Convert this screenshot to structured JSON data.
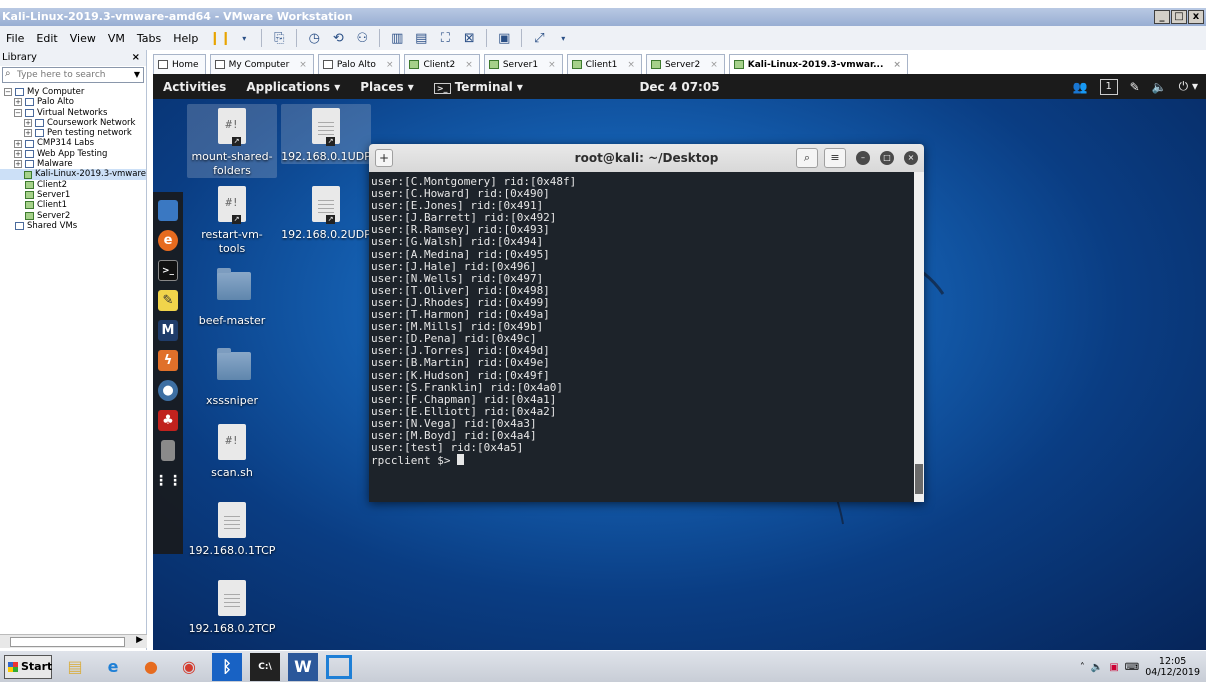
{
  "window": {
    "title": "Kali-Linux-2019.3-vmware-amd64 - VMware Workstation",
    "controls": [
      "_",
      "□",
      "x"
    ]
  },
  "menu": [
    "File",
    "Edit",
    "View",
    "VM",
    "Tabs",
    "Help"
  ],
  "library": {
    "title": "Library",
    "close": "×",
    "search_placeholder": "Type here to search",
    "tree": [
      {
        "label": "My Computer",
        "exp": "−",
        "indent": 0,
        "icon": "folder"
      },
      {
        "label": "Palo Alto",
        "exp": "+",
        "indent": 1,
        "icon": "folder"
      },
      {
        "label": "Virtual Networks",
        "exp": "−",
        "indent": 1,
        "icon": "folder"
      },
      {
        "label": "Coursework Network",
        "exp": "+",
        "indent": 2,
        "icon": "folder"
      },
      {
        "label": "Pen testing network",
        "exp": "+",
        "indent": 2,
        "icon": "folder"
      },
      {
        "label": "CMP314 Labs",
        "exp": "+",
        "indent": 1,
        "icon": "folder"
      },
      {
        "label": "Web App Testing",
        "exp": "+",
        "indent": 1,
        "icon": "folder"
      },
      {
        "label": "Malware",
        "exp": "+",
        "indent": 1,
        "icon": "folder"
      },
      {
        "label": "Kali-Linux-2019.3-vmware",
        "exp": "",
        "indent": 1,
        "icon": "vm",
        "selected": true
      },
      {
        "label": "Client2",
        "exp": "",
        "indent": 1,
        "icon": "vm"
      },
      {
        "label": "Server1",
        "exp": "",
        "indent": 1,
        "icon": "vm"
      },
      {
        "label": "Client1",
        "exp": "",
        "indent": 1,
        "icon": "vm"
      },
      {
        "label": "Server2",
        "exp": "",
        "indent": 1,
        "icon": "vm"
      },
      {
        "label": "Shared VMs",
        "exp": "",
        "indent": 0,
        "icon": "folder"
      }
    ]
  },
  "tabs": [
    {
      "label": "Home",
      "icon": "home-icon"
    },
    {
      "label": "My Computer",
      "icon": "computer-icon"
    },
    {
      "label": "Palo Alto",
      "icon": "folder-icon"
    },
    {
      "label": "Client2",
      "icon": "vm-icon"
    },
    {
      "label": "Server1",
      "icon": "vm-icon"
    },
    {
      "label": "Client1",
      "icon": "vm-icon"
    },
    {
      "label": "Server2",
      "icon": "vm-icon"
    },
    {
      "label": "Kali-Linux-2019.3-vmwar...",
      "icon": "vm-icon",
      "active": true
    }
  ],
  "kali": {
    "activities": "Activities",
    "applications": "Applications ▾",
    "places": "Places ▾",
    "terminal_menu": "Terminal ▾",
    "clock": "Dec 4  07:05",
    "workspace": "1"
  },
  "desktop_icons": [
    {
      "label": "mount-shared-\nfolders",
      "type": "script",
      "selected": true
    },
    {
      "label": "192.168.0.1UDP",
      "type": "doc",
      "selected": true
    },
    {
      "label": "restart-vm-\ntools",
      "type": "script"
    },
    {
      "label": "192.168.0.2UDP",
      "type": "doc"
    },
    {
      "label": "beef-master",
      "type": "folder"
    },
    {
      "label": "xsssniper",
      "type": "folder"
    },
    {
      "label": "scan.sh",
      "type": "script"
    },
    {
      "label": "192.168.0.1TCP",
      "type": "doc"
    },
    {
      "label": "192.168.0.2TCP",
      "type": "doc"
    }
  ],
  "terminal": {
    "title": "root@kali: ~/Desktop",
    "lines": [
      "user:[C.Montgomery] rid:[0x48f]",
      "user:[C.Howard] rid:[0x490]",
      "user:[E.Jones] rid:[0x491]",
      "user:[J.Barrett] rid:[0x492]",
      "user:[R.Ramsey] rid:[0x493]",
      "user:[G.Walsh] rid:[0x494]",
      "user:[A.Medina] rid:[0x495]",
      "user:[J.Hale] rid:[0x496]",
      "user:[N.Wells] rid:[0x497]",
      "user:[T.Oliver] rid:[0x498]",
      "user:[J.Rhodes] rid:[0x499]",
      "user:[T.Harmon] rid:[0x49a]",
      "user:[M.Mills] rid:[0x49b]",
      "user:[D.Pena] rid:[0x49c]",
      "user:[J.Torres] rid:[0x49d]",
      "user:[B.Martin] rid:[0x49e]",
      "user:[K.Hudson] rid:[0x49f]",
      "user:[S.Franklin] rid:[0x4a0]",
      "user:[F.Chapman] rid:[0x4a1]",
      "user:[E.Elliott] rid:[0x4a2]",
      "user:[N.Vega] rid:[0x4a3]",
      "user:[M.Boyd] rid:[0x4a4]",
      "user:[test] rid:[0x4a5]"
    ],
    "prompt": "rpcclient $> "
  },
  "taskbar": {
    "start": "Start",
    "time": "12:05",
    "date": "04/12/2019"
  }
}
